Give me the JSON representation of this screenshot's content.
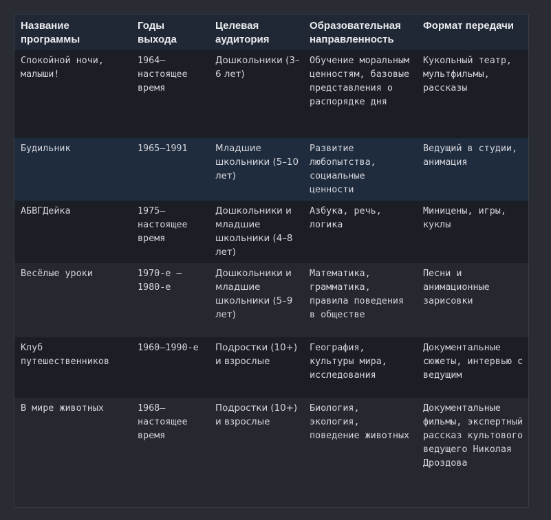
{
  "table": {
    "headers": [
      "Название программы",
      "Годы выхода",
      "Целевая аудитория",
      "Образовательная направленность",
      "Формат передачи"
    ],
    "rows": [
      [
        "Спокойной ночи, малыши!",
        "1964–настоящее время",
        "Дошкольники (3–6 лет)",
        "Обучение моральным ценностям, базовые представления о распорядке дня",
        "Кукольный театр, мультфильмы, рассказы"
      ],
      [
        "Будильник",
        "1965–1991",
        "Младшие школьники (5–10 лет)",
        "Развитие любопытства, социальные ценности",
        "Ведущий в студии, анимация"
      ],
      [
        "АБВГДейка",
        "1975–настоящее время",
        "Дошкольники и младшие школьники (4–8 лет)",
        "Азбука, речь, логика",
        "Миницены, игры, куклы"
      ],
      [
        "Весёлые уроки",
        "1970-е – 1980-е",
        "Дошкольники и младшие школьники (5–9 лет)",
        "Математика, грамматика, правила поведения в обществе",
        "Песни и анимационные зарисовки"
      ],
      [
        "Клуб путешественников",
        "1960–1990-е",
        "Подростки (10+) и взрослые",
        "География, культуры мира, исследования",
        "Документальные сюжеты, интервью с ведущим"
      ],
      [
        "В мире животных",
        "1968–настоящее время",
        "Подростки (10+) и взрослые",
        "Биология, экология, поведение животных",
        "Документальные фильмы, экспертный рассказ культового ведущего Николая Дроздова"
      ]
    ]
  }
}
